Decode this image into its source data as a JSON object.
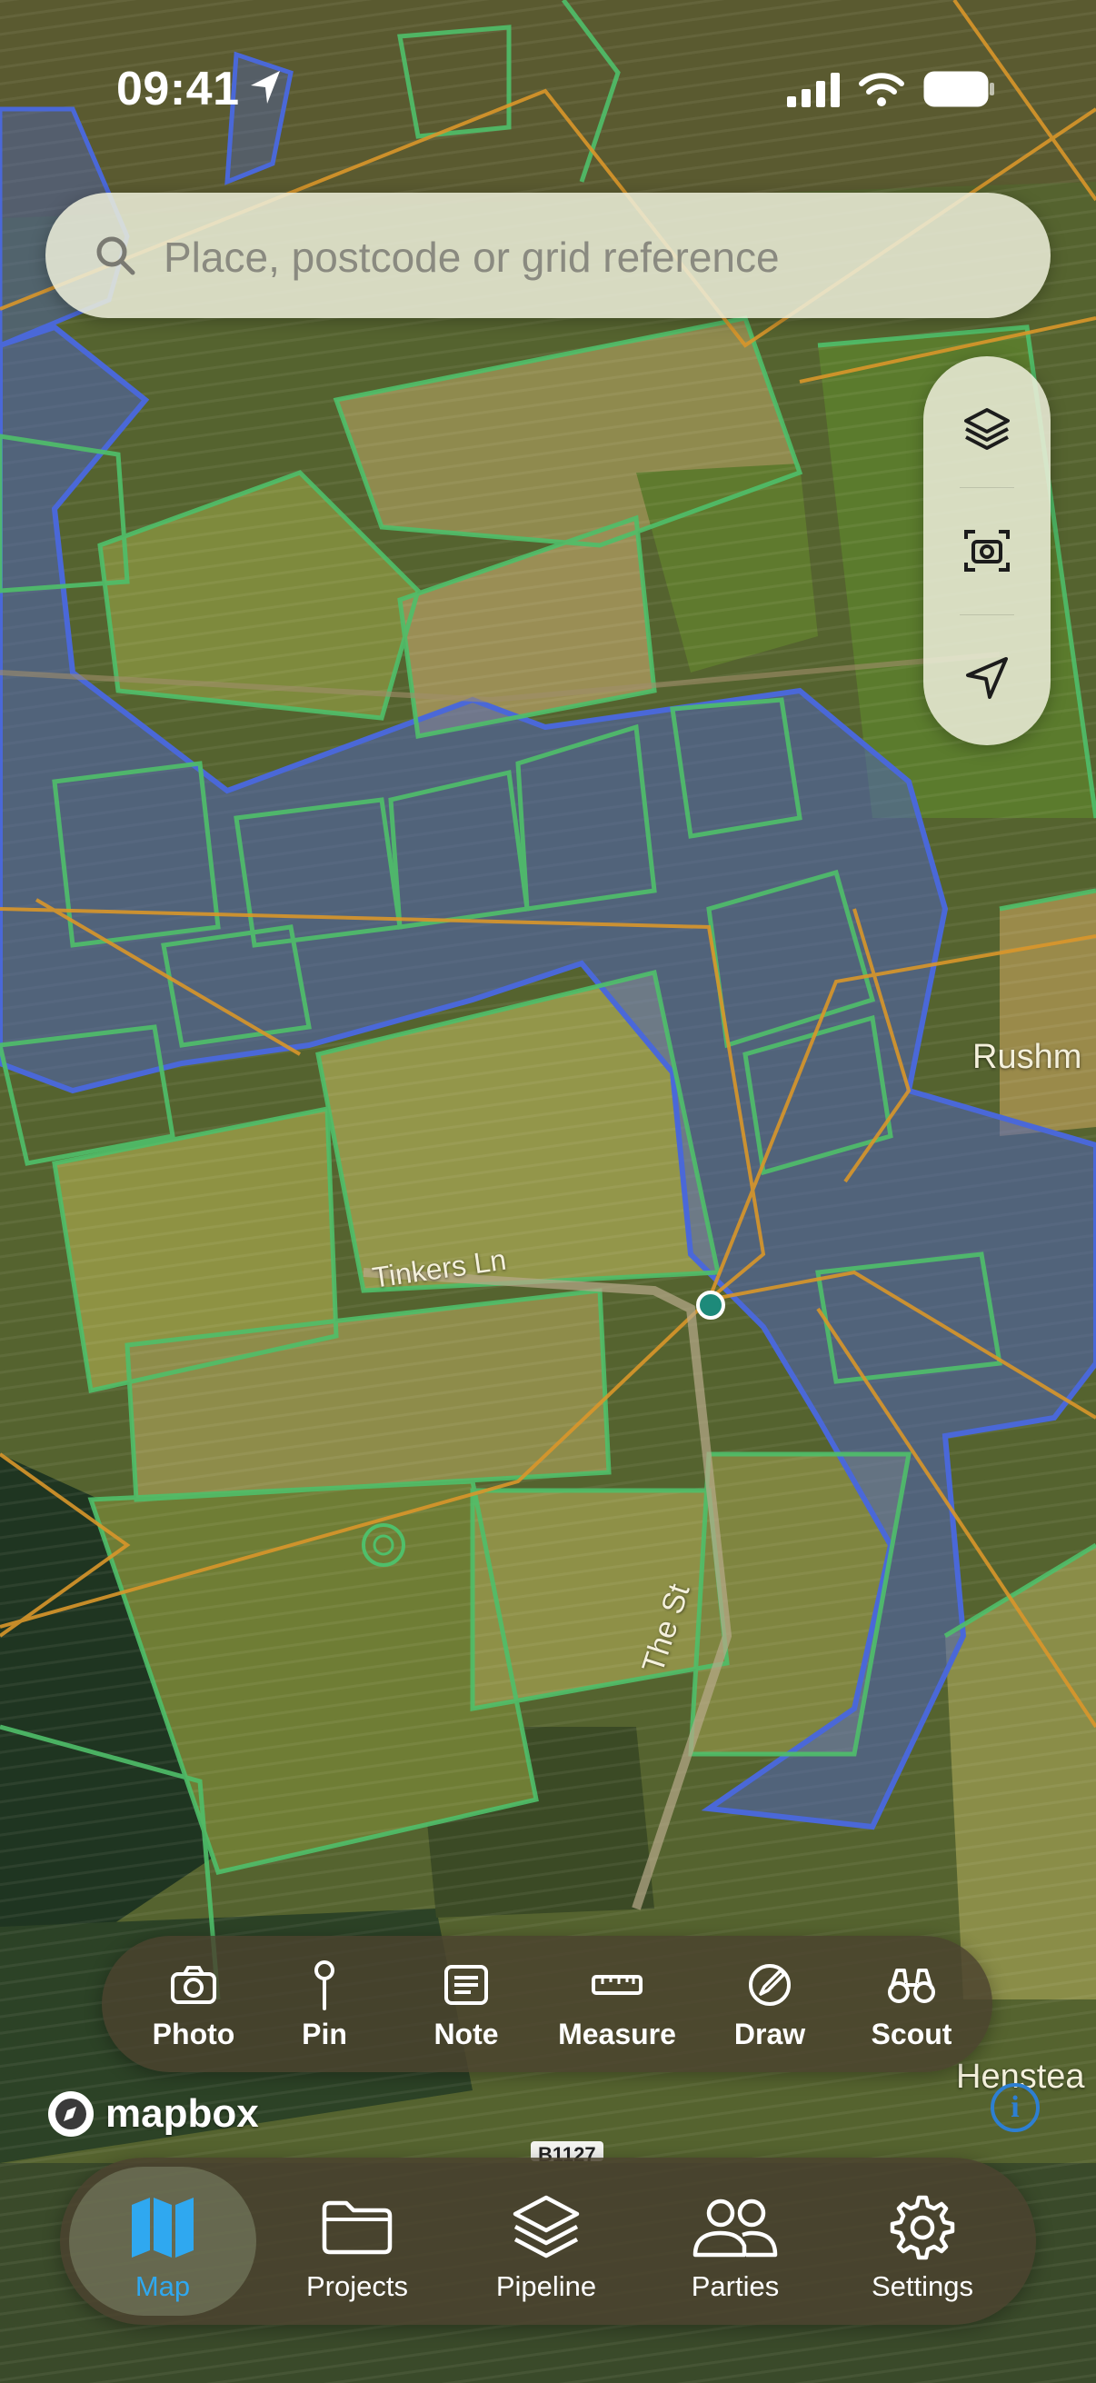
{
  "status_bar": {
    "time": "09:41"
  },
  "search": {
    "placeholder": "Place, postcode or grid reference"
  },
  "map_labels": {
    "road_1": "Tinkers Ln",
    "road_2": "The St",
    "place_1": "Rushm",
    "place_2": "Henstea",
    "road_sign": "B1127"
  },
  "side_controls": [
    "layers-icon",
    "camera-scan-icon",
    "navigation-arrow-icon"
  ],
  "toolbar": [
    {
      "label": "Photo",
      "icon": "camera-icon"
    },
    {
      "label": "Pin",
      "icon": "pin-icon"
    },
    {
      "label": "Note",
      "icon": "note-icon"
    },
    {
      "label": "Measure",
      "icon": "ruler-icon"
    },
    {
      "label": "Draw",
      "icon": "draw-icon"
    },
    {
      "label": "Scout",
      "icon": "binoculars-icon"
    }
  ],
  "attribution": {
    "brand": "mapbox"
  },
  "tabs": [
    {
      "label": "Map",
      "icon": "map-icon",
      "active": true
    },
    {
      "label": "Projects",
      "icon": "folder-icon",
      "active": false
    },
    {
      "label": "Pipeline",
      "icon": "stack-icon",
      "active": false
    },
    {
      "label": "Parties",
      "icon": "people-icon",
      "active": false
    },
    {
      "label": "Settings",
      "icon": "gear-icon",
      "active": false
    }
  ],
  "colors": {
    "accent": "#2fa8f0",
    "field_outline": "#4fbf6a",
    "flood_zone": "#4e64b8",
    "boundary": "#d9962a",
    "bar_bg": "#4a422e"
  }
}
